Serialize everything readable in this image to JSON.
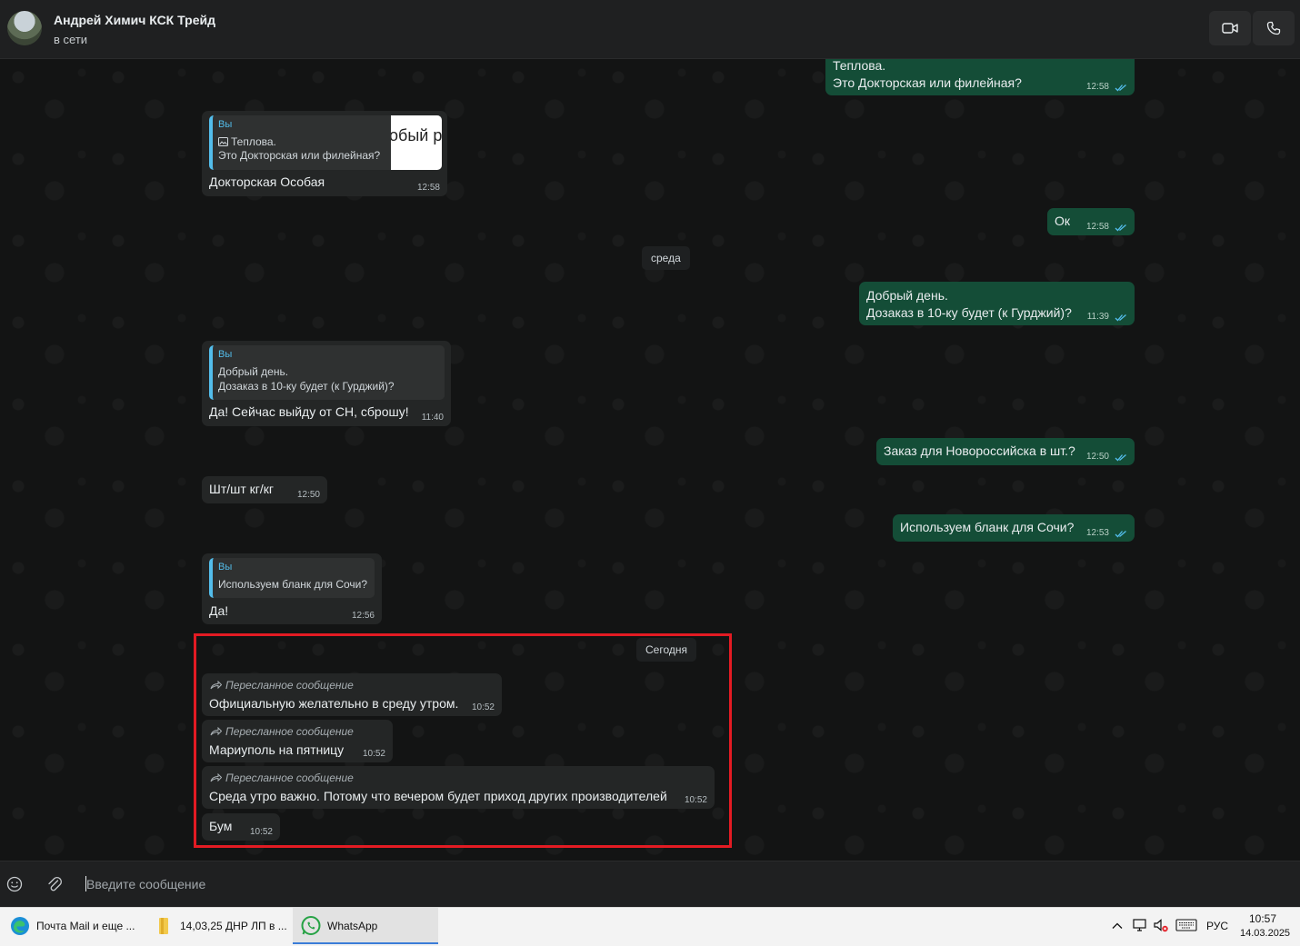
{
  "header": {
    "contact_name": "Андрей Химич КСК Трейд",
    "status": "в сети",
    "video_icon": "video-camera-icon",
    "call_icon": "phone-icon"
  },
  "messages": {
    "m1": {
      "line1": "Теплова.",
      "line2": "Это Докторская или филейная?",
      "time": "12:58"
    },
    "m2": {
      "quote_author": "Вы",
      "quote_line1": "Теплова.",
      "quote_line2": "Это Докторская или филейная?",
      "quote_thumb_text": "обый р",
      "text": "Докторская Особая",
      "time": "12:58"
    },
    "m3": {
      "text": "Ок",
      "time": "12:58"
    },
    "date1": "среда",
    "m4": {
      "line1": "Добрый день.",
      "line2": "Дозаказ в 10-ку будет (к Гурджий)?",
      "time": "11:39"
    },
    "m5": {
      "quote_author": "Вы",
      "quote_line1": "Добрый день.",
      "quote_line2": "Дозаказ в 10-ку будет (к Гурджий)?",
      "text": "Да! Сейчас выйду от СН, сброшу!",
      "time": "11:40"
    },
    "m6": {
      "text": "Заказ для Новороссийска в шт.?",
      "time": "12:50"
    },
    "m7": {
      "text": "Шт/шт кг/кг",
      "time": "12:50"
    },
    "m8": {
      "text": "Используем бланк для Сочи?",
      "time": "12:53"
    },
    "m9": {
      "quote_author": "Вы",
      "quote_line1": "Используем бланк для Сочи?",
      "text": "Да!",
      "time": "12:56"
    },
    "date2": "Сегодня",
    "m10": {
      "forward_label": "Пересланное сообщение",
      "text": "Официальную желательно в среду утром.",
      "time": "10:52"
    },
    "m11": {
      "forward_label": "Пересланное сообщение",
      "text": "Мариуполь на пятницу",
      "time": "10:52"
    },
    "m12": {
      "forward_label": "Пересланное сообщение",
      "text": "Среда утро важно. Потому что вечером будет приход других производителей",
      "time": "10:52"
    },
    "m13": {
      "text": "Бум",
      "time": "10:52"
    }
  },
  "composer": {
    "placeholder": "Введите сообщение",
    "emoji_icon": "emoji-icon",
    "attach_icon": "paperclip-icon"
  },
  "taskbar": {
    "mail_label": "Почта Mail и еще ...",
    "folder_label": "14,03,25 ДНР ЛП в ...",
    "whatsapp_label": "WhatsApp",
    "lang": "РУС",
    "time": "10:57",
    "date": "14.03.2025"
  },
  "colors": {
    "outgoing_bubble": "#144d37",
    "incoming_bubble": "#242626",
    "quote_accent": "#53bdeb",
    "highlight": "#e31b23",
    "read_ticks": "#53bdeb"
  }
}
